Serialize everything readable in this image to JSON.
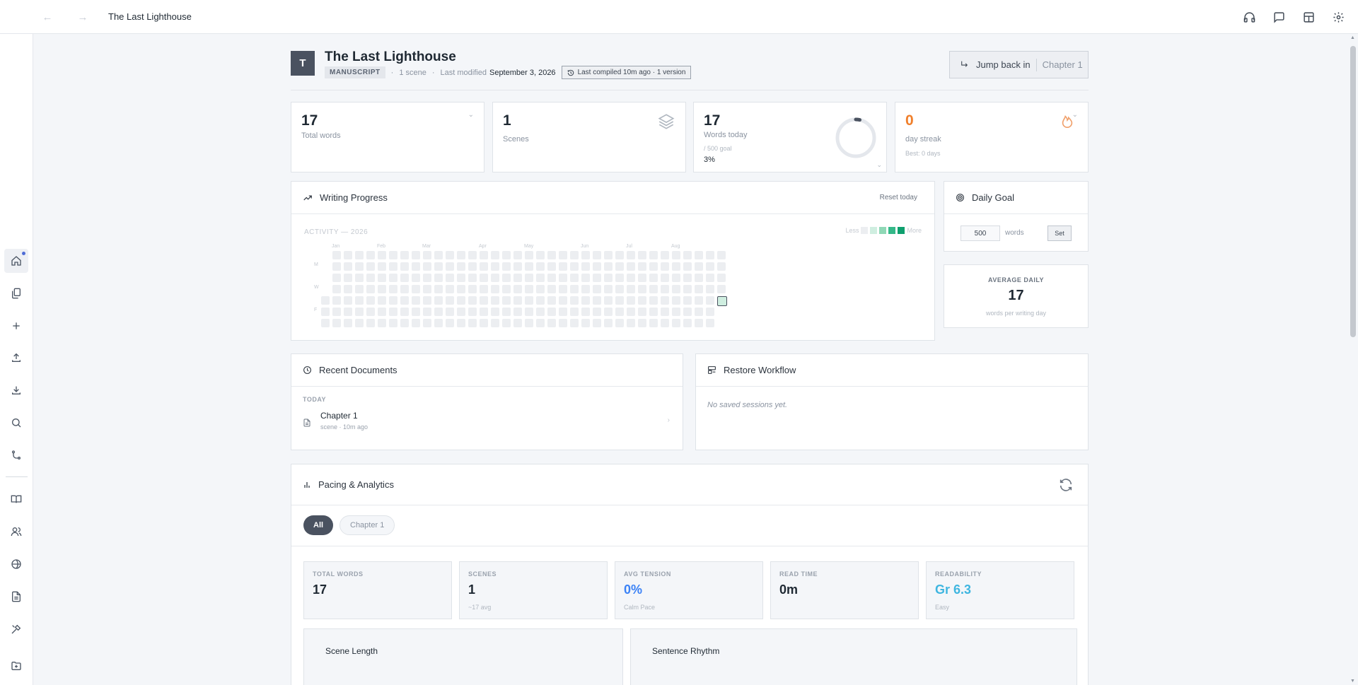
{
  "app": {
    "title": "The Last Lighthouse"
  },
  "project": {
    "avatar_letter": "T",
    "title": "The Last Lighthouse",
    "badge": "MANUSCRIPT",
    "scene_count": "1 scene",
    "last_modified_label": "Last modified",
    "last_modified": "September 3, 2026",
    "compile_status": "Last compiled 10m ago · 1 version"
  },
  "jump": {
    "label": "Jump back in",
    "chapter": "Chapter 1"
  },
  "stats": {
    "total_words": {
      "value": "17",
      "label": "Total words"
    },
    "scenes": {
      "value": "1",
      "label": "Scenes"
    },
    "words_today": {
      "value": "17",
      "label": "Words today",
      "goal": "/ 500 goal",
      "percent": "3%",
      "progress_fraction": 0.034
    },
    "streak": {
      "value": "0",
      "label": "day streak",
      "best": "Best: 0 days"
    }
  },
  "writing_progress": {
    "title": "Writing Progress",
    "reset": "Reset today",
    "activity_label": "ACTIVITY — 2026",
    "legend_less": "Less",
    "legend_more": "More",
    "months": [
      "Jan",
      "Feb",
      "Mar",
      "Apr",
      "May",
      "Jun",
      "Jul",
      "Aug"
    ],
    "days": [
      "M",
      "W",
      "F"
    ]
  },
  "daily_goal": {
    "title": "Daily Goal",
    "value": "500",
    "unit": "words",
    "set_label": "Set"
  },
  "average": {
    "label": "AVERAGE DAILY",
    "value": "17",
    "sub": "words per writing day"
  },
  "recent": {
    "title": "Recent Documents",
    "group": "TODAY",
    "items": [
      {
        "name": "Chapter 1",
        "meta": "scene · 10m ago"
      }
    ]
  },
  "restore": {
    "title": "Restore Workflow",
    "empty": "No saved sessions yet."
  },
  "pacing": {
    "title": "Pacing & Analytics",
    "filters": [
      "All",
      "Chapter 1"
    ],
    "metrics": [
      {
        "label": "TOTAL WORDS",
        "value": "17",
        "sub": "",
        "color": "#1f2933"
      },
      {
        "label": "SCENES",
        "value": "1",
        "sub": "~17 avg",
        "color": "#1f2933"
      },
      {
        "label": "AVG TENSION",
        "value": "0%",
        "sub": "Calm Pace",
        "color": "#3b82f6"
      },
      {
        "label": "READ TIME",
        "value": "0m",
        "sub": "",
        "color": "#1f2933"
      },
      {
        "label": "READABILITY",
        "value": "Gr 6.3",
        "sub": "Easy",
        "color": "#3fb6e0"
      }
    ],
    "scene_length_title": "Scene Length",
    "sentence_rhythm_title": "Sentence Rhythm"
  },
  "colors": {
    "accent": "#4f6cd6",
    "streak": "#f07f2b",
    "heat_active": "#0e9f6e"
  }
}
